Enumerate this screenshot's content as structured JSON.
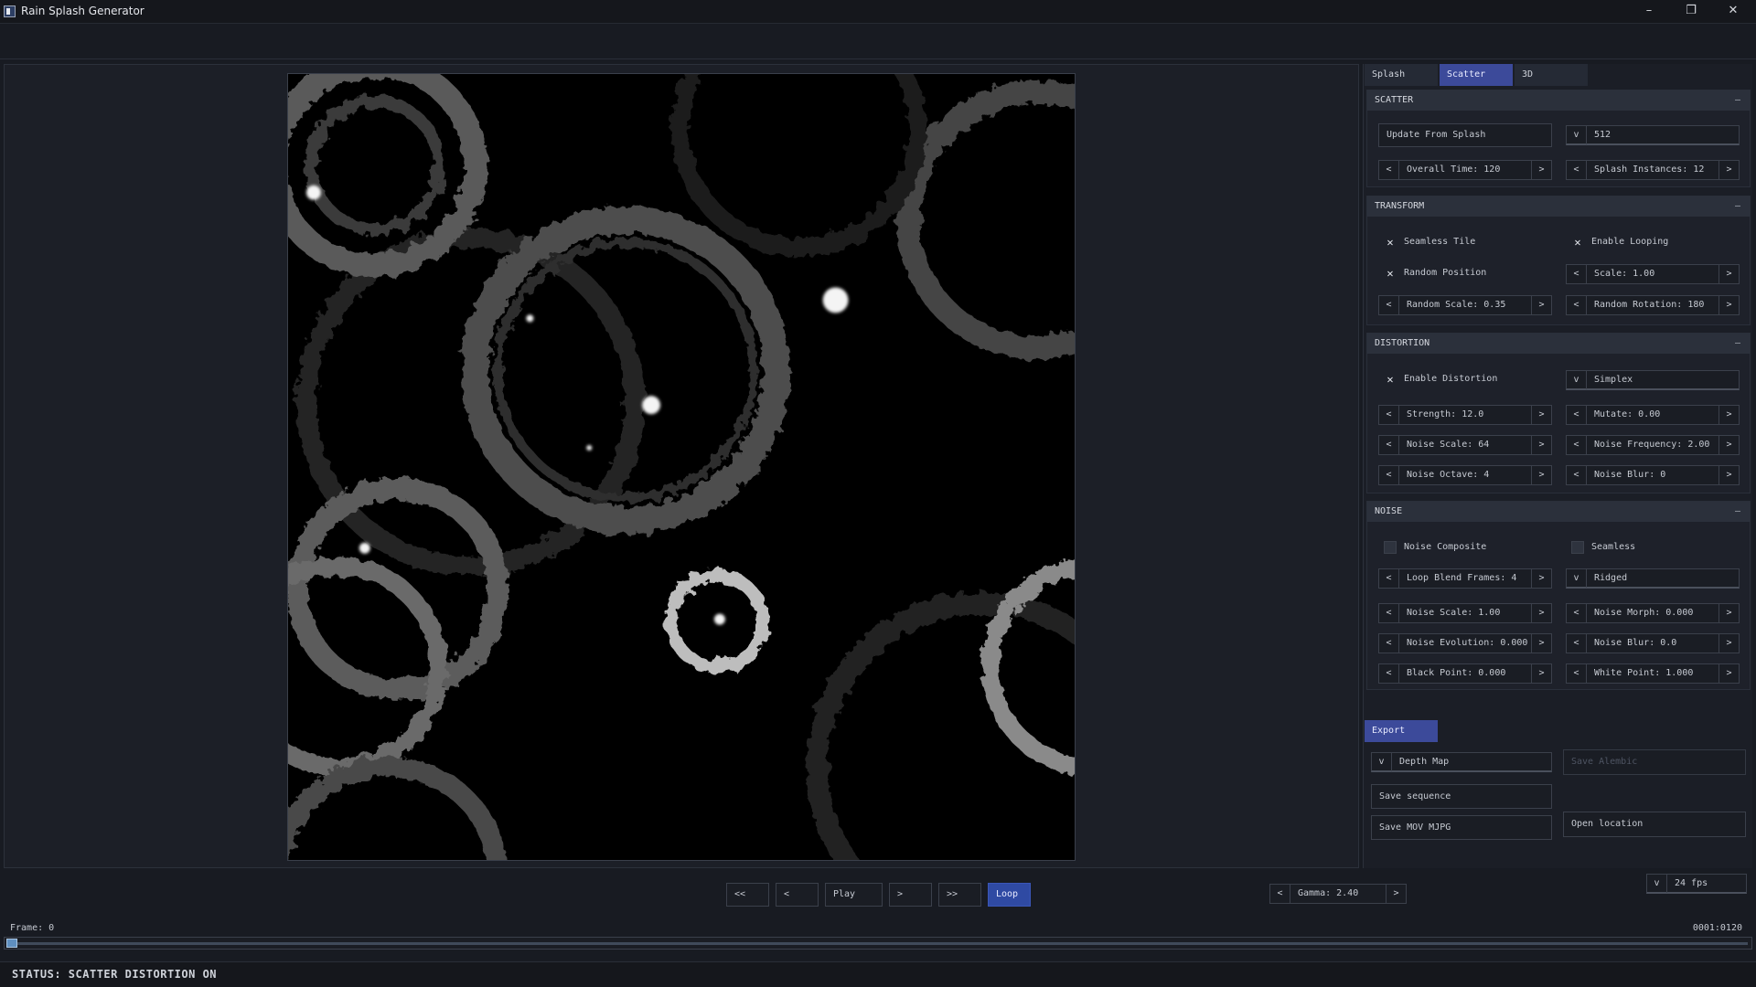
{
  "window": {
    "title": "Rain Splash Generator",
    "minimize": "–",
    "restore": "❐",
    "close": "✕"
  },
  "tabs": [
    {
      "label": "Splash",
      "active": false
    },
    {
      "label": "Scatter",
      "active": true
    },
    {
      "label": "3D",
      "active": false
    }
  ],
  "scatter": {
    "title": "SCATTER",
    "collapse": "–",
    "update_button": "Update From Splash",
    "resolution": "512",
    "overall_time": "Overall Time: 120",
    "splash_instances": "Splash Instances: 12"
  },
  "transform": {
    "title": "TRANSFORM",
    "collapse": "–",
    "seamless_tile": {
      "label": "Seamless Tile",
      "checked": true
    },
    "enable_looping": {
      "label": "Enable Looping",
      "checked": true
    },
    "random_position": {
      "label": "Random Position",
      "checked": true
    },
    "scale": "Scale: 1.00",
    "random_scale": "Random Scale: 0.35",
    "random_rotation": "Random Rotation: 180"
  },
  "distortion": {
    "title": "DISTORTION",
    "collapse": "–",
    "enable": {
      "label": "Enable Distortion",
      "checked": true
    },
    "noise_type": "Simplex",
    "strength": "Strength: 12.0",
    "mutate": "Mutate: 0.00",
    "noise_scale": "Noise Scale: 64",
    "noise_frequency": "Noise Frequency: 2.00",
    "noise_octave": "Noise Octave: 4",
    "noise_blur": "Noise Blur: 0"
  },
  "noise": {
    "title": "NOISE",
    "collapse": "–",
    "composite": {
      "label": "Noise Composite",
      "checked": false
    },
    "seamless": {
      "label": "Seamless",
      "checked": false
    },
    "loop_blend": "Loop Blend Frames: 4",
    "type": "Ridged",
    "noise_scale": "Noise Scale: 1.00",
    "noise_morph": "Noise Morph: 0.000",
    "noise_evolution": "Noise Evolution: 0.000",
    "noise_blur": "Noise Blur: 0.0",
    "black_point": "Black Point: 0.000",
    "white_point": "White Point: 1.000"
  },
  "export": {
    "tab": "Export",
    "format": "Depth Map",
    "save_alembic": "Save Alembic",
    "save_sequence": "Save sequence",
    "save_mov": "Save MOV MJPG",
    "open_location": "Open location"
  },
  "transport": {
    "first": "<<",
    "prev": "<",
    "play": "Play",
    "next": ">",
    "last": ">>",
    "loop": "Loop",
    "gamma": "Gamma: 2.40",
    "fps": "24 fps"
  },
  "timeline": {
    "frame_label": "Frame: 0",
    "counter": "0001:0120",
    "position": 0
  },
  "status": {
    "text": "STATUS: SCATTER DISTORTION ON"
  },
  "glyphs": {
    "left": "<",
    "right": ">",
    "down": "v",
    "check": "✕"
  },
  "colors": {
    "accent": "#3c4a9a",
    "loop_active": "#2f4aa3",
    "background": "#181b22"
  }
}
